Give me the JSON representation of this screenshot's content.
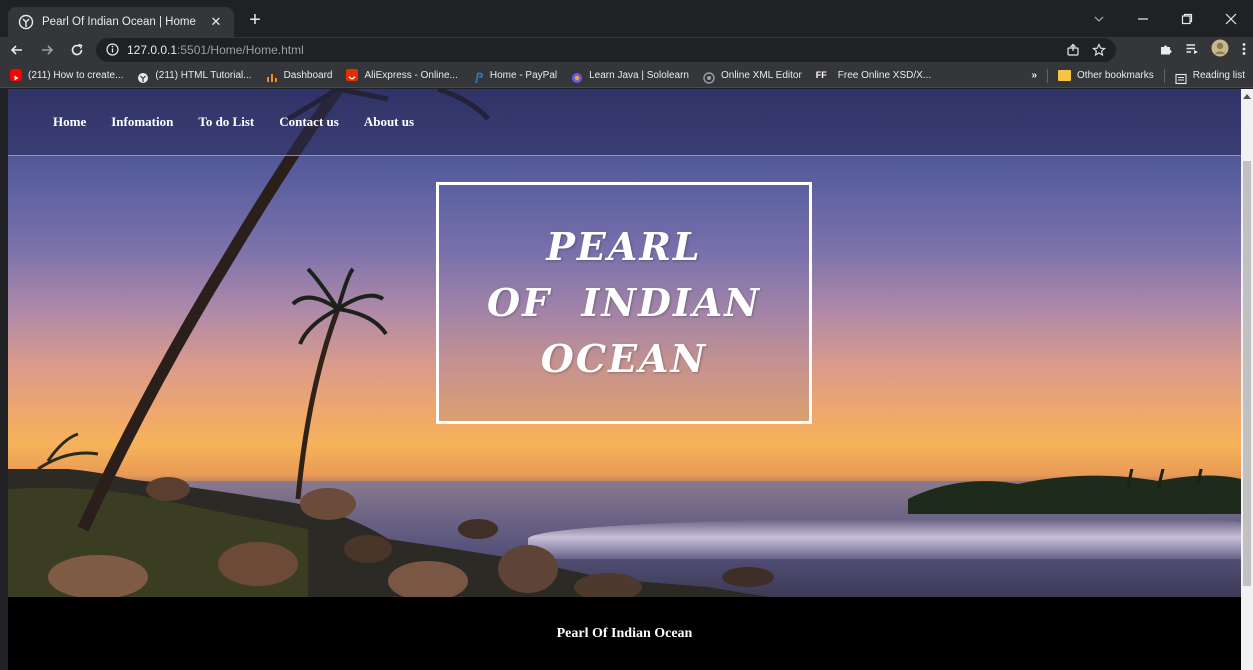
{
  "browser": {
    "tab": {
      "title": "Pearl Of Indian Ocean | Home",
      "favicon": "globe-icon"
    },
    "url": {
      "host": "127.0.0.1",
      "rest": ":5501/Home/Home.html"
    },
    "bookmarks": [
      {
        "label": "(211) How to create...",
        "icon": "youtube-icon",
        "color": "#ff0000"
      },
      {
        "label": "(211) HTML Tutorial...",
        "icon": "globe-icon",
        "color": "#e8eaed"
      },
      {
        "label": "Dashboard",
        "icon": "dashboard-icon",
        "color": "#f28b22"
      },
      {
        "label": "AliExpress - Online...",
        "icon": "aliexpress-icon",
        "color": "#e62e04"
      },
      {
        "label": "Home - PayPal",
        "icon": "paypal-icon",
        "color": "#2a7fd8"
      },
      {
        "label": "Learn Java | Sololearn",
        "icon": "sololearn-icon",
        "color": "#6b5be8"
      },
      {
        "label": "Online XML Editor",
        "icon": "xml-editor-icon",
        "color": "#9aa0a6"
      },
      {
        "label": "Free Online XSD/X...",
        "icon": "ff-icon",
        "color": "#ffffff"
      }
    ],
    "more_bookmarks": "»",
    "other_bookmarks": "Other bookmarks",
    "reading_list": "Reading list"
  },
  "page": {
    "nav": [
      "Home",
      "Infomation",
      "To do List",
      "Contact us",
      "About us"
    ],
    "title_lines": [
      "PEARL",
      "OF  INDIAN",
      "OCEAN"
    ],
    "footer": "Pearl Of Indian Ocean"
  }
}
